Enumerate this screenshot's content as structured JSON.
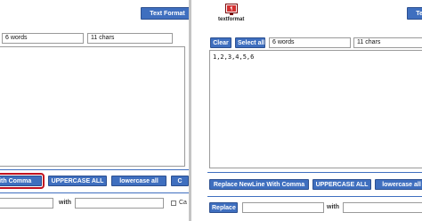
{
  "left": {
    "header_button": "Text Format",
    "word_count": "6 words",
    "char_count": "11 chars",
    "buttons": [
      "Replace NewLine With Comma",
      "UPPERCASE ALL",
      "lowercase all",
      "C"
    ],
    "with_label": "with",
    "checkbox_label": "Ca"
  },
  "right": {
    "logo_text": "textformat",
    "header_button": "Text Format",
    "clear": "Clear",
    "select_all": "Select all",
    "word_count": "6 words",
    "char_count": "11 chars",
    "content": "1,2,3,4,5,6",
    "buttons": [
      "Replace NewLine With Comma",
      "UPPERCASE ALL",
      "lowercase all"
    ],
    "replace_button": "Replace",
    "with_label": "with"
  },
  "colors": {
    "button": "#3f6fbf",
    "highlight": "#c1121f"
  }
}
